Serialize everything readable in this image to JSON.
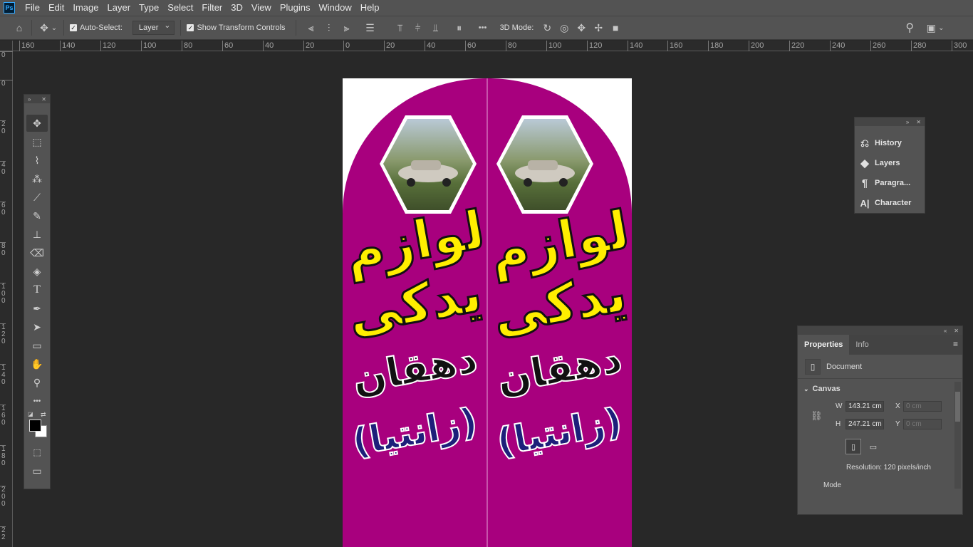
{
  "app": {
    "logo": "Ps"
  },
  "menu": [
    "File",
    "Edit",
    "Image",
    "Layer",
    "Type",
    "Select",
    "Filter",
    "3D",
    "View",
    "Plugins",
    "Window",
    "Help"
  ],
  "options": {
    "auto_select_label": "Auto-Select:",
    "auto_select_value": "Layer",
    "transform_label": "Show Transform Controls",
    "mode_3d_label": "3D Mode:",
    "more": "•••"
  },
  "rulers": {
    "horizontal": [
      "160",
      "140",
      "120",
      "100",
      "80",
      "60",
      "40",
      "20",
      "0",
      "20",
      "40",
      "60",
      "80",
      "100",
      "120",
      "140",
      "160",
      "180",
      "200",
      "220",
      "240",
      "260",
      "280",
      "300"
    ],
    "vertical": [
      "0",
      "0",
      "2 0",
      "4 0",
      "6 0",
      "8 0",
      "1 0 0",
      "1 2 0",
      "1 4 0",
      "1 6 0",
      "1 8 0",
      "2 0 0",
      "2 2"
    ]
  },
  "tools": [
    {
      "name": "move-tool",
      "glyph": "✥"
    },
    {
      "name": "marquee-tool",
      "glyph": "⬚"
    },
    {
      "name": "lasso-tool",
      "glyph": "⌇"
    },
    {
      "name": "magic-wand-tool",
      "glyph": "⁂"
    },
    {
      "name": "eyedropper-tool",
      "glyph": "⟋"
    },
    {
      "name": "brush-tool",
      "glyph": "✎"
    },
    {
      "name": "stamp-tool",
      "glyph": "⊥"
    },
    {
      "name": "eraser-tool",
      "glyph": "⌫"
    },
    {
      "name": "paint-bucket-tool",
      "glyph": "◈"
    },
    {
      "name": "type-tool",
      "glyph": "T"
    },
    {
      "name": "pen-tool",
      "glyph": "✒"
    },
    {
      "name": "path-selection-tool",
      "glyph": "➤"
    },
    {
      "name": "rectangle-tool",
      "glyph": "▭"
    },
    {
      "name": "hand-tool",
      "glyph": "✋"
    },
    {
      "name": "zoom-tool",
      "glyph": "⚲"
    },
    {
      "name": "more-tools",
      "glyph": "•••"
    }
  ],
  "panel_history": {
    "items": [
      {
        "label": "History",
        "icon": "history-icon",
        "glyph": "⎌"
      },
      {
        "label": "Layers",
        "icon": "layers-icon",
        "glyph": "◆"
      },
      {
        "label": "Paragra...",
        "icon": "paragraph-icon",
        "glyph": "¶"
      },
      {
        "label": "Character",
        "icon": "character-icon",
        "glyph": "A|"
      }
    ]
  },
  "properties": {
    "tab_properties": "Properties",
    "tab_info": "Info",
    "document_label": "Document",
    "canvas_section": "Canvas",
    "w_label": "W",
    "w_value": "143.21 cm",
    "h_label": "H",
    "h_value": "247.21 cm",
    "x_label": "X",
    "x_placeholder": "0 cm",
    "y_label": "Y",
    "y_placeholder": "0 cm",
    "resolution": "Resolution: 120 pixels/inch",
    "mode_label": "Mode"
  },
  "artwork": {
    "line1": "لوازم",
    "line2": "یدکی",
    "line3": "دهقان",
    "line4": "(زانتیا)",
    "colors": {
      "magenta": "#a8007e",
      "yellow": "#ffee00",
      "navy": "#1d1f7a"
    }
  }
}
